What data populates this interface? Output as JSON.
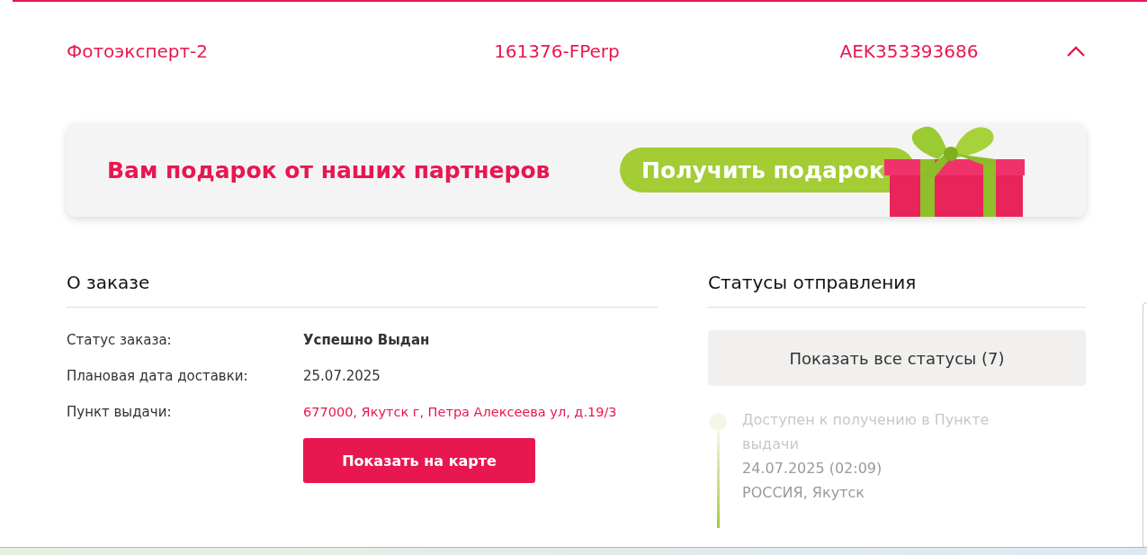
{
  "order_header": {
    "shop": "Фотоэксперт-2",
    "order_number": "161376-FPerp",
    "tracking_number": "AEK353393686",
    "expanded": true
  },
  "banner": {
    "title": "Вам подарок от наших партнеров",
    "button": "Получить подарок"
  },
  "order_info": {
    "heading": "О заказе",
    "fields": [
      {
        "label": "Статус заказа:",
        "value": "Успешно Выдан",
        "kind": "bold"
      },
      {
        "label": "Плановая дата доставки:",
        "value": "25.07.2025",
        "kind": "plain"
      },
      {
        "label": "Пункт выдачи:",
        "value": "677000, Якутск г, Петра Алексеева ул, д.19/3",
        "kind": "link"
      }
    ],
    "map_button": "Показать на карте"
  },
  "statuses": {
    "heading": "Статусы отправления",
    "show_all_button": "Показать все статусы (7)",
    "events": [
      {
        "title": "Доступен к получению в Пункте выдачи",
        "date": "24.07.2025 (02:09)",
        "place": "РОССИЯ, Якутск"
      }
    ]
  }
}
